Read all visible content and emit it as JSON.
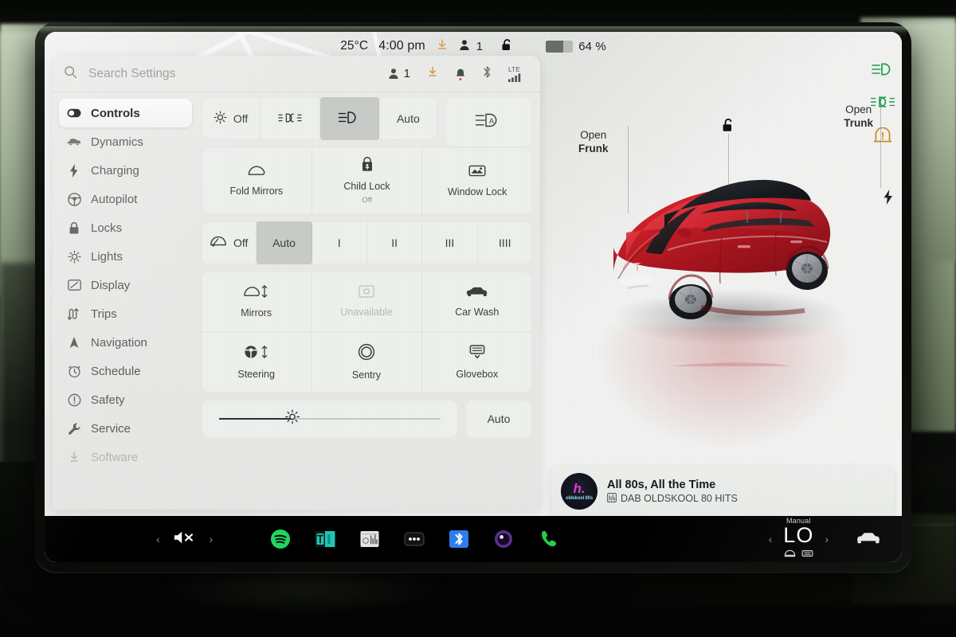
{
  "statusbar": {
    "temperature": "25°C",
    "time": "4:00 pm",
    "download_icon": "download-icon",
    "occupants": "1",
    "lock_icon": "unlocked-padlock-icon",
    "battery_percent": "64 %",
    "battery_level": 64
  },
  "search": {
    "placeholder": "Search Settings",
    "profile_count": "1",
    "lte_label": "LTE"
  },
  "sidebar": {
    "items": [
      {
        "label": "Controls",
        "icon": "toggle-icon",
        "active": true
      },
      {
        "label": "Dynamics",
        "icon": "car-side-icon",
        "active": false
      },
      {
        "label": "Charging",
        "icon": "bolt-icon",
        "active": false
      },
      {
        "label": "Autopilot",
        "icon": "steering-wheel-icon",
        "active": false
      },
      {
        "label": "Locks",
        "icon": "padlock-icon",
        "active": false
      },
      {
        "label": "Lights",
        "icon": "sun-icon",
        "active": false
      },
      {
        "label": "Display",
        "icon": "display-icon",
        "active": false
      },
      {
        "label": "Trips",
        "icon": "trips-icon",
        "active": false
      },
      {
        "label": "Navigation",
        "icon": "navigation-arrow-icon",
        "active": false
      },
      {
        "label": "Schedule",
        "icon": "clock-icon",
        "active": false
      },
      {
        "label": "Safety",
        "icon": "exclamation-circle-icon",
        "active": false
      },
      {
        "label": "Service",
        "icon": "wrench-icon",
        "active": false
      },
      {
        "label": "Software",
        "icon": "download-icon",
        "active": false
      }
    ]
  },
  "controls": {
    "lights_row": [
      {
        "label": "Off",
        "icon": "lights-off-icon",
        "selected": false
      },
      {
        "label": "",
        "icon": "parking-lights-icon",
        "selected": false
      },
      {
        "label": "",
        "icon": "low-beam-icon",
        "selected": true
      },
      {
        "label": "Auto",
        "icon": "",
        "selected": false
      }
    ],
    "auto_highbeam": {
      "label": "",
      "icon": "auto-high-beam-icon"
    },
    "lock_tiles": [
      {
        "label": "Fold Mirrors",
        "sub": "",
        "icon": "mirror-icon"
      },
      {
        "label": "Child Lock",
        "sub": "Off",
        "icon": "child-lock-icon"
      },
      {
        "label": "Window Lock",
        "sub": "",
        "icon": "window-lock-icon"
      }
    ],
    "wiper_row": [
      {
        "label": "Off",
        "icon": "wiper-icon",
        "selected": false
      },
      {
        "label": "Auto",
        "icon": "",
        "selected": true
      },
      {
        "label": "I",
        "icon": "",
        "selected": false
      },
      {
        "label": "II",
        "icon": "",
        "selected": false
      },
      {
        "label": "III",
        "icon": "",
        "selected": false
      },
      {
        "label": "IIII",
        "icon": "",
        "selected": false
      }
    ],
    "feature_tiles": [
      {
        "label": "Mirrors",
        "icon": "mirror-adjust-icon",
        "disabled": false
      },
      {
        "label": "Unavailable",
        "icon": "unavailable-icon",
        "disabled": true
      },
      {
        "label": "Car Wash",
        "icon": "car-front-icon",
        "disabled": false
      },
      {
        "label": "Steering",
        "icon": "steering-adjust-icon",
        "disabled": false
      },
      {
        "label": "Sentry",
        "icon": "sentry-icon",
        "disabled": false
      },
      {
        "label": "Glovebox",
        "icon": "glovebox-icon",
        "disabled": false
      }
    ],
    "brightness": {
      "icon": "brightness-icon",
      "value": 33,
      "auto_label": "Auto"
    }
  },
  "carview": {
    "frunk_top": "Open",
    "frunk_bottom": "Frunk",
    "trunk_top": "Open",
    "trunk_bottom": "Trunk",
    "lock_icon": "unlocked-padlock-icon",
    "charge_icon": "charge-bolt-icon",
    "car_color": "#c41f28",
    "indicators": [
      {
        "icon": "low-beam-indicator-icon",
        "color": "#1f9d4e"
      },
      {
        "icon": "parking-lights-indicator-icon",
        "color": "#1f9d4e"
      },
      {
        "icon": "tire-pressure-warning-icon",
        "color": "#c98a20"
      }
    ]
  },
  "media": {
    "title": "All 80s, All the Time",
    "station": "DAB OLDSKOOL 80 HITS",
    "art_primary": "h.",
    "art_secondary": "oldskool 80s",
    "controls": [
      {
        "icon": "previous-track-icon"
      },
      {
        "icon": "stop-icon"
      },
      {
        "icon": "next-track-icon"
      },
      {
        "icon": "star-icon"
      },
      {
        "icon": "equalizer-icon"
      },
      {
        "icon": "search-icon"
      }
    ]
  },
  "taskbar": {
    "volume_icon": "volume-mute-icon",
    "prev_chevron": "‹",
    "next_chevron": "›",
    "apps": [
      {
        "name": "spotify-app-icon",
        "color": "#1ed760"
      },
      {
        "name": "tunein-app-icon",
        "color": "#1ec7b6"
      },
      {
        "name": "radio-app-icon",
        "color": "#d9dbd8"
      },
      {
        "name": "more-apps-icon",
        "color": "#1c1c1c"
      },
      {
        "name": "bluetooth-app-icon",
        "color": "#2d7ff0"
      },
      {
        "name": "dashcam-app-icon",
        "color": "#5b2f8e"
      },
      {
        "name": "phone-app-icon",
        "color": "#27d04a"
      }
    ],
    "climate": {
      "mode": "Manual",
      "temp": "LO",
      "vent_left": "seat-vent-icon",
      "vent_right": "front-vent-icon"
    },
    "car_icon": "car-front-icon"
  }
}
